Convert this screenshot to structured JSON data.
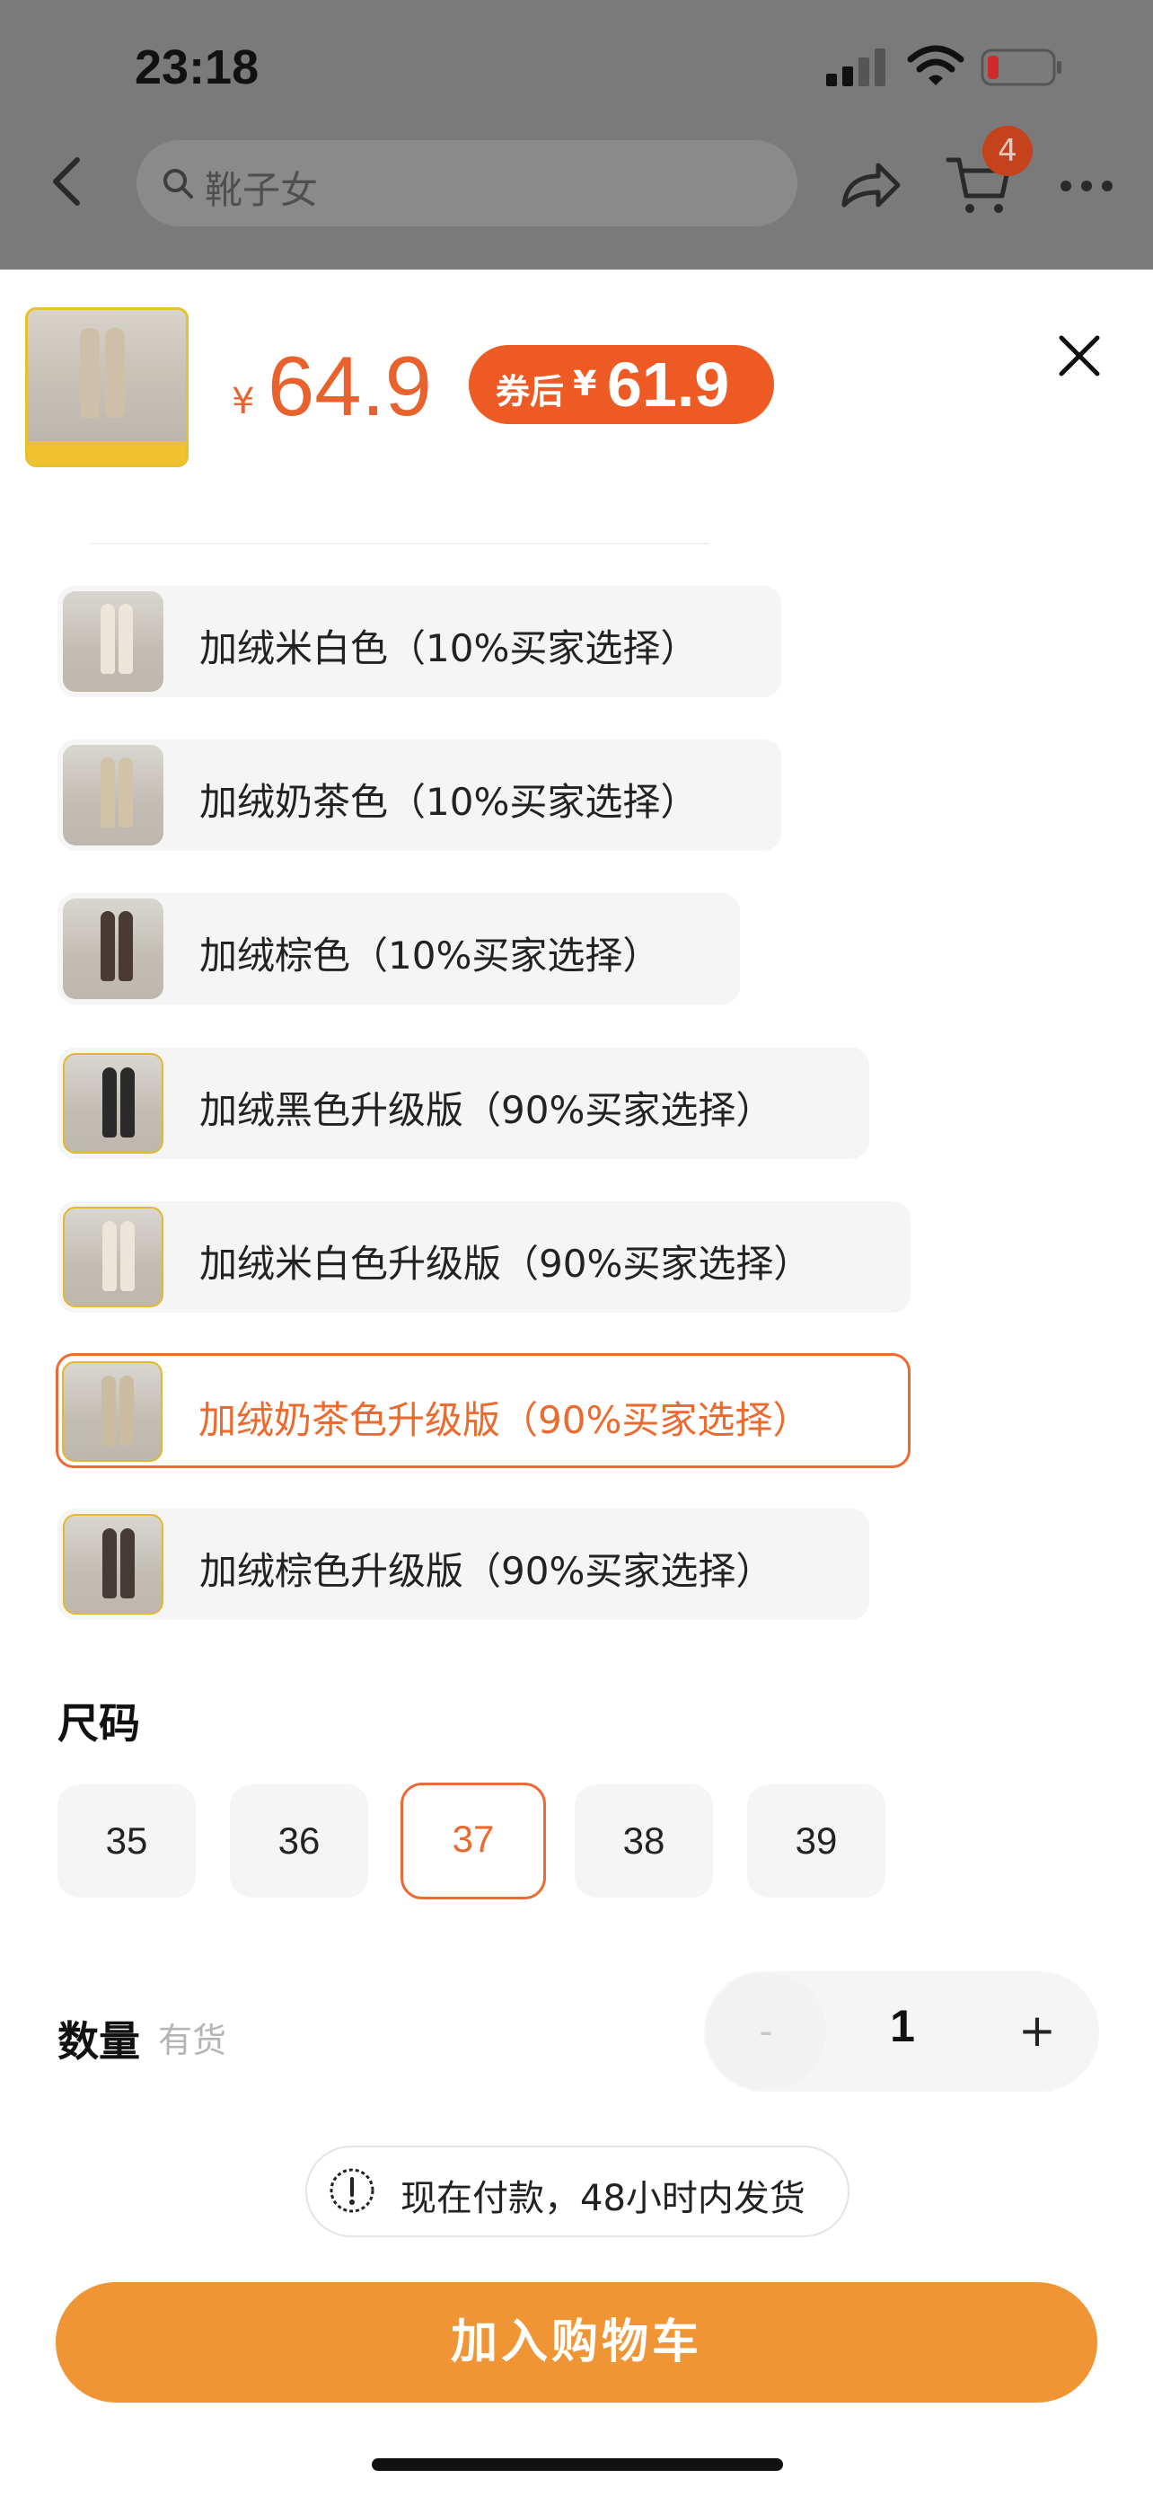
{
  "status_bar": {
    "time": "23:18"
  },
  "header": {
    "search_text": "靴子女",
    "cart_count": "4"
  },
  "sheet": {
    "price_symbol": "¥",
    "price": "64.9",
    "coupon_label": "券后",
    "coupon_symbol": "¥",
    "coupon_price": "61.9"
  },
  "color_options": [
    {
      "label": "加绒米白色（10%买家选择）",
      "selected": false,
      "boot_color": "#ece6da",
      "badge": false
    },
    {
      "label": "加绒奶茶色（10%买家选择）",
      "selected": false,
      "boot_color": "#d2c3a8",
      "badge": false
    },
    {
      "label": "加绒棕色（10%买家选择）",
      "selected": false,
      "boot_color": "#4a3a34",
      "badge": false
    },
    {
      "label": "加绒黑色升级版（90%买家选择）",
      "selected": false,
      "boot_color": "#2a2a2a",
      "badge": true
    },
    {
      "label": "加绒米白色升级版（90%买家选择）",
      "selected": false,
      "boot_color": "#ece6da",
      "badge": true
    },
    {
      "label": "加绒奶茶色升级版（90%买家选择）",
      "selected": true,
      "boot_color": "#cbbba0",
      "badge": true
    },
    {
      "label": "加绒棕色升级版（90%买家选择）",
      "selected": false,
      "boot_color": "#463a36",
      "badge": true
    }
  ],
  "size": {
    "title": "尺码",
    "options": [
      "35",
      "36",
      "37",
      "38",
      "39"
    ],
    "selected": "37"
  },
  "quantity": {
    "title": "数量",
    "stock": "有货",
    "minus": "-",
    "value": "1",
    "plus": "+"
  },
  "shipping_notice": "现在付款，48小时内发货",
  "add_to_cart_label": "加入购物车",
  "colors": {
    "accent": "#ee6a32",
    "cta": "#f09535"
  }
}
